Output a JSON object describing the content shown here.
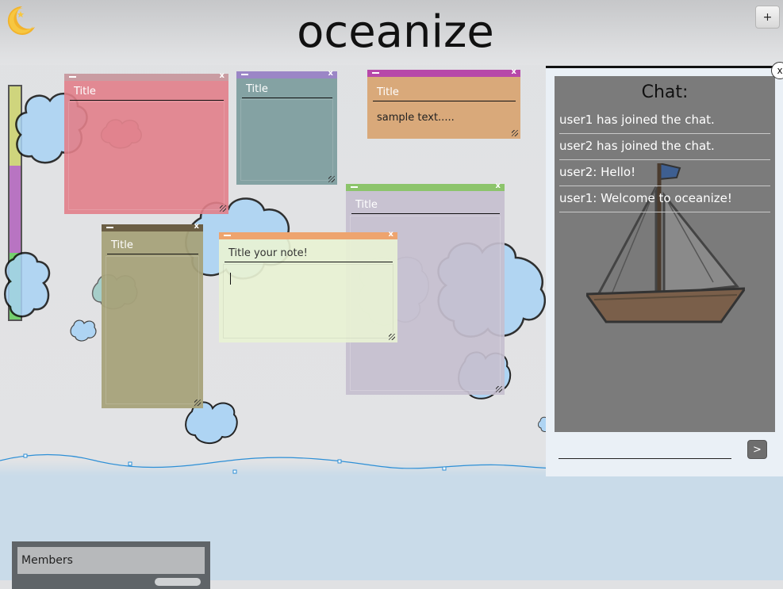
{
  "app": {
    "title": "oceanize"
  },
  "header": {
    "add_label": "+"
  },
  "colors": {
    "pink_note": "#e27f89",
    "teal_note": "#7e9e9f",
    "orange_note": "#d8a574",
    "olive_note": "#a6a27a",
    "lavender_note": "#c5bfcf",
    "lightgreen_note": "#e8f2d4",
    "chat_panel": "#7b7b7b"
  },
  "notes": [
    {
      "title": "Title",
      "text": ""
    },
    {
      "title": "Title",
      "text": ""
    },
    {
      "title": "Title",
      "text": "sample text....."
    },
    {
      "title": "Title",
      "text": ""
    },
    {
      "title": "Title",
      "text": ""
    },
    {
      "title": "",
      "placeholder": "Title your note!",
      "text": ""
    }
  ],
  "note_close": "x",
  "chat": {
    "title": "Chat:",
    "close_label": "x",
    "send_label": ">",
    "input_value": "",
    "messages": [
      "user1 has joined the chat.",
      "user2 has joined the chat.",
      "user2: Hello!",
      "user1: Welcome to oceanize!"
    ]
  },
  "members": {
    "label": "Members"
  }
}
